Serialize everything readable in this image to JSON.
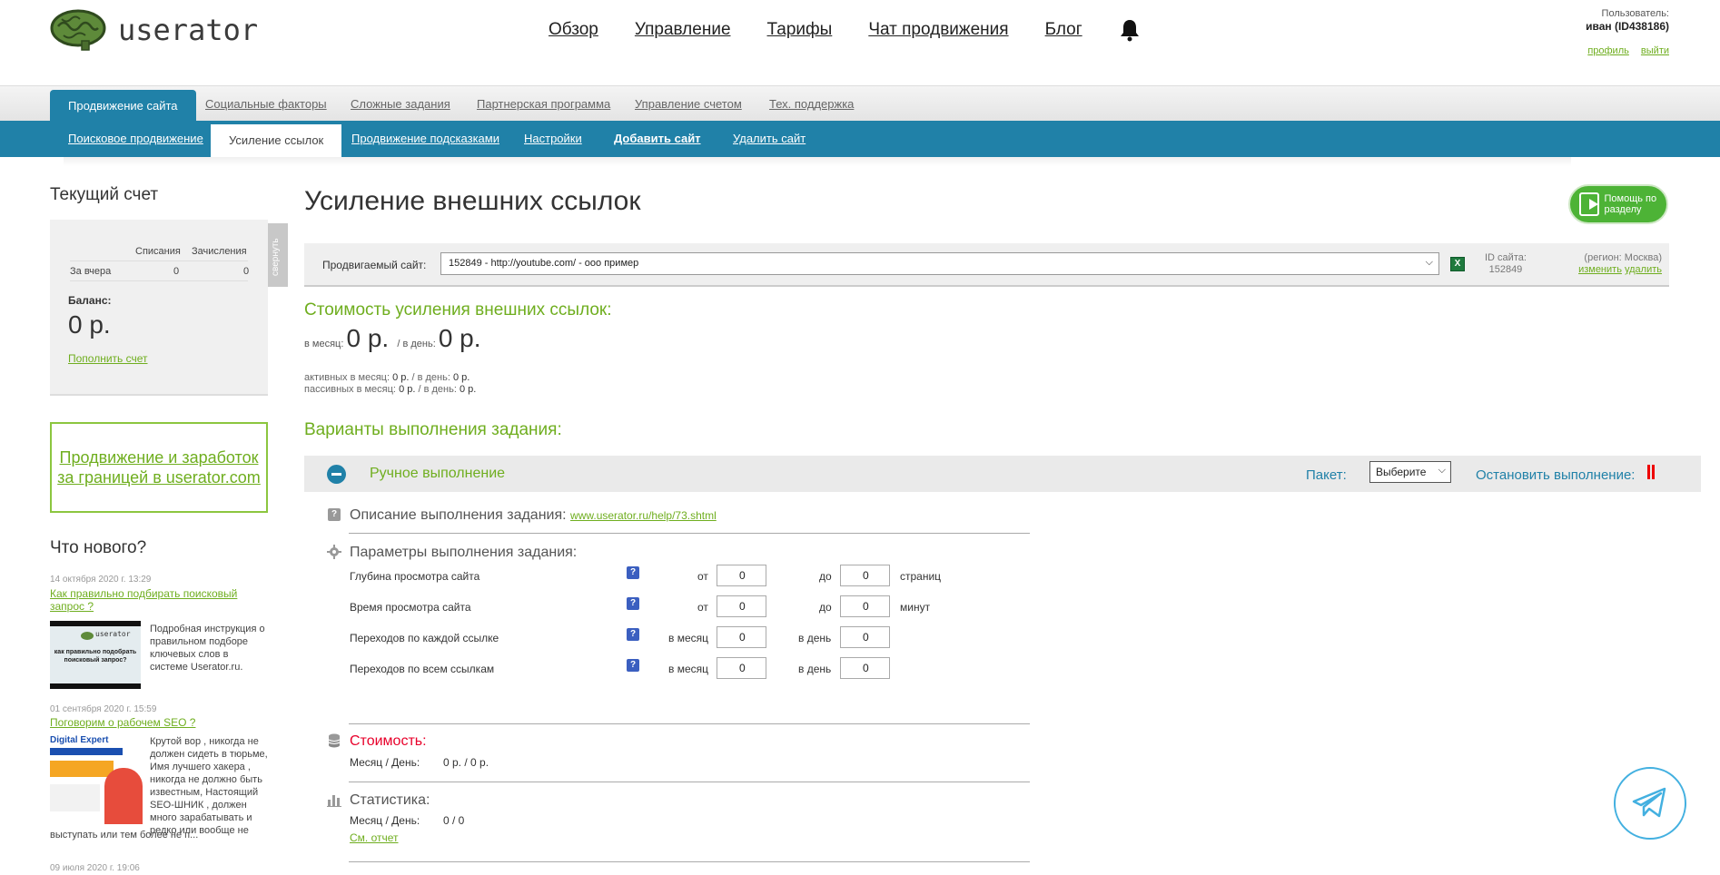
{
  "header": {
    "logo_text": "userator",
    "nav": [
      "Обзор",
      "Управление",
      "Тарифы",
      "Чат продвижения",
      "Блог"
    ],
    "user_label": "Пользователь:",
    "user_name": "иван (ID438186)",
    "profile_link": "профиль",
    "logout_link": "выйти"
  },
  "tabs_primary": [
    "Продвижение сайта",
    "Социальные факторы",
    "Сложные задания",
    "Партнерская программа",
    "Управление счетом",
    "Тех. поддержка"
  ],
  "tabs_secondary": [
    "Поисковое продвижение",
    "Усиление ссылок",
    "Продвижение подсказками",
    "Настройки",
    "Добавить сайт",
    "Удалить сайт"
  ],
  "sidebar": {
    "account_title": "Текущий счет",
    "collapse_label": "свернуть",
    "col_debit": "Списания",
    "col_credit": "Зачисления",
    "row_label": "За вчера",
    "row_debit": "0",
    "row_credit": "0",
    "balance_label": "Баланс:",
    "balance_value": "0 р.",
    "topup_link": "Пополнить счет",
    "promo": "Продвижение и заработок за границей в userator.com",
    "news_title": "Что нового?",
    "news": [
      {
        "date": "14 октября 2020 г. 13:29",
        "title": "Как правильно подбирать поисковый запрос ?",
        "text": "Подробная инструкция о правильном подборе ключевых слов в системе Userator.ru.",
        "img_caption": "как правильно подобрать поисковый запрос?"
      },
      {
        "date": "01 сентября 2020 г. 15:59",
        "title": "Поговорим о рабочем SEO ?",
        "text_top": "Крутой вор , никогда не должен сидеть в тюрьме, Имя лучшего хакера , никогда не должно быть известным, Настоящий SEO-ШНИК , должен много зарабатывать и редко или вообще не",
        "text_bottom": "выступать или тем более не п...",
        "img_caption": "Digital Expert"
      },
      {
        "date": "09 июля 2020 г. 19:06"
      }
    ]
  },
  "main": {
    "title": "Усиление внешних ссылок",
    "help_button": "Помощь по разделу",
    "site_label": "Продвигаемый сайт:",
    "site_value": "152849 - http://youtube.com/ - ооо пример",
    "site_id_label": "ID сайта:",
    "site_id": "152849",
    "region": "(регион: Москва)",
    "region_change": "изменить",
    "region_delete": "удалить",
    "cost_title": "Стоимость усиления внешних ссылок:",
    "per_month_label": "в месяц:",
    "per_month_value": "0 р.",
    "per_day_label": "/ в день:",
    "per_day_value": "0 р.",
    "active_line": "активных в месяц:",
    "active_month": "0 р.",
    "active_day_label": "/ в день:",
    "active_day": "0 р.",
    "passive_line": "пассивных в месяц:",
    "passive_month": "0 р.",
    "passive_day_label": "/ в день:",
    "passive_day": "0 р.",
    "variants_title": "Варианты выполнения задания:",
    "exec_title": "Ручное выполнение",
    "package_label": "Пакет:",
    "package_value": "Выберите",
    "stop_label": "Остановить выполнение:",
    "desc_label": "Описание выполнения задания:",
    "desc_link": "www.userator.ru/help/73.shtml",
    "params_label": "Параметры выполнения задания:",
    "params": [
      {
        "name": "Глубина просмотра сайта",
        "l1": "от",
        "v1": "0",
        "l2": "до",
        "v2": "0",
        "unit": "страниц"
      },
      {
        "name": "Время просмотра сайта",
        "l1": "от",
        "v1": "0",
        "l2": "до",
        "v2": "0",
        "unit": "минут"
      },
      {
        "name": "Переходов по каждой ссылке",
        "l1": "в месяц",
        "v1": "0",
        "l2": "в день",
        "v2": "0",
        "unit": ""
      },
      {
        "name": "Переходов по всем ссылкам",
        "l1": "в месяц",
        "v1": "0",
        "l2": "в день",
        "v2": "0",
        "unit": ""
      }
    ],
    "cost_section_title": "Стоимость:",
    "cost_kv_label": "Месяц / День:",
    "cost_kv_value": "0 р. / 0 р.",
    "stats_title": "Статистика:",
    "stats_kv_label": "Месяц / День:",
    "stats_kv_value": "0 / 0",
    "stats_link": "См. отчет"
  },
  "colors": {
    "accent_green": "#6fae1f",
    "accent_blue": "#2081a8",
    "red": "#e8002a"
  }
}
